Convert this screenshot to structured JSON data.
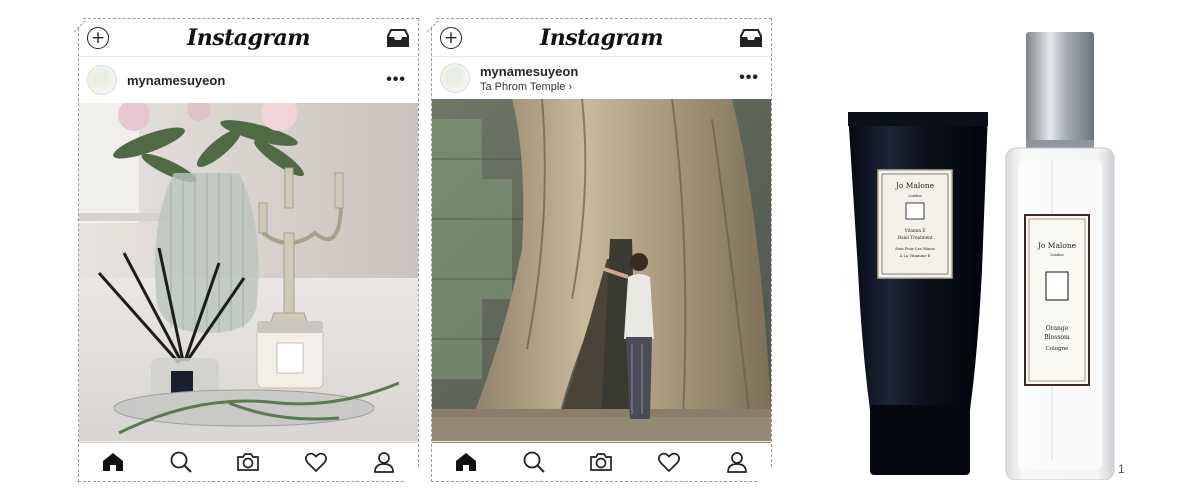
{
  "app": {
    "logo_text": "Instagram"
  },
  "posts": [
    {
      "username": "mynamesuyeon",
      "location": "",
      "more": "•••"
    },
    {
      "username": "mynamesuyeon",
      "location": "Ta Phrom Temple ›",
      "more": "•••"
    }
  ],
  "tabs": [
    "home-icon",
    "search-icon",
    "camera-icon",
    "heart-icon",
    "profile-icon"
  ],
  "products": {
    "tube": {
      "brand": "Jo Malone",
      "city": "London",
      "line1": "Vitamin E",
      "line2": "Hand Treatment",
      "line3": "Soin Pour Les Mains",
      "line4": "À La Vitamine E"
    },
    "bottle": {
      "brand": "Jo Malone",
      "city": "London",
      "line1": "Orange",
      "line2": "Blossom",
      "line3": "Cologne"
    }
  },
  "page_number": "1",
  "colors": {
    "border": "#9a9a9a",
    "tube": "#0e1421",
    "cap": "#9aa0a8"
  }
}
